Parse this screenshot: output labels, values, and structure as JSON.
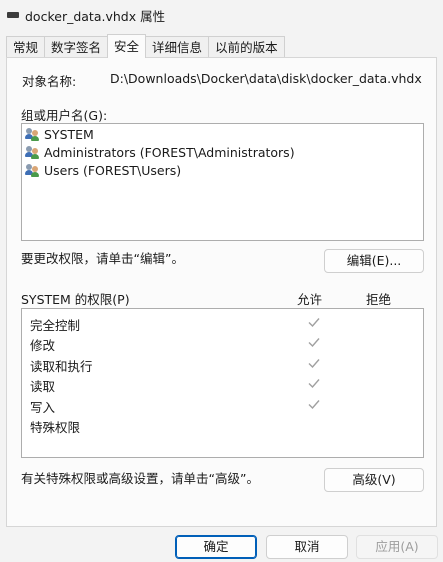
{
  "window": {
    "title": "docker_data.vhdx 属性"
  },
  "tabs": [
    {
      "label": "常规"
    },
    {
      "label": "数字签名"
    },
    {
      "label": "安全"
    },
    {
      "label": "详细信息"
    },
    {
      "label": "以前的版本"
    }
  ],
  "security": {
    "object_name_label": "对象名称:",
    "object_name_value": "D:\\Downloads\\Docker\\data\\disk\\docker_data.vhdx",
    "groups_label": "组或用户名(G):",
    "groups": [
      {
        "name": "SYSTEM"
      },
      {
        "name": "Administrators (FOREST\\Administrators)"
      },
      {
        "name": "Users (FOREST\\Users)"
      }
    ],
    "edit_hint": "要更改权限，请单击“编辑”。",
    "edit_button": "编辑(E)...",
    "permissions_label": "SYSTEM 的权限(P)",
    "allow_header": "允许",
    "deny_header": "拒绝",
    "permissions": [
      {
        "name": "完全控制",
        "allow": true,
        "deny": false
      },
      {
        "name": "修改",
        "allow": true,
        "deny": false
      },
      {
        "name": "读取和执行",
        "allow": true,
        "deny": false
      },
      {
        "name": "读取",
        "allow": true,
        "deny": false
      },
      {
        "name": "写入",
        "allow": true,
        "deny": false
      },
      {
        "name": "特殊权限",
        "allow": false,
        "deny": false
      }
    ],
    "advanced_hint": "有关特殊权限或高级设置，请单击“高级”。",
    "advanced_button": "高级(V)"
  },
  "footer": {
    "ok_button": "确定",
    "cancel_button": "取消",
    "apply_button": "应用(A)"
  },
  "colors": {
    "accent": "#005fb8",
    "check_gray": "#a0a0a0"
  }
}
